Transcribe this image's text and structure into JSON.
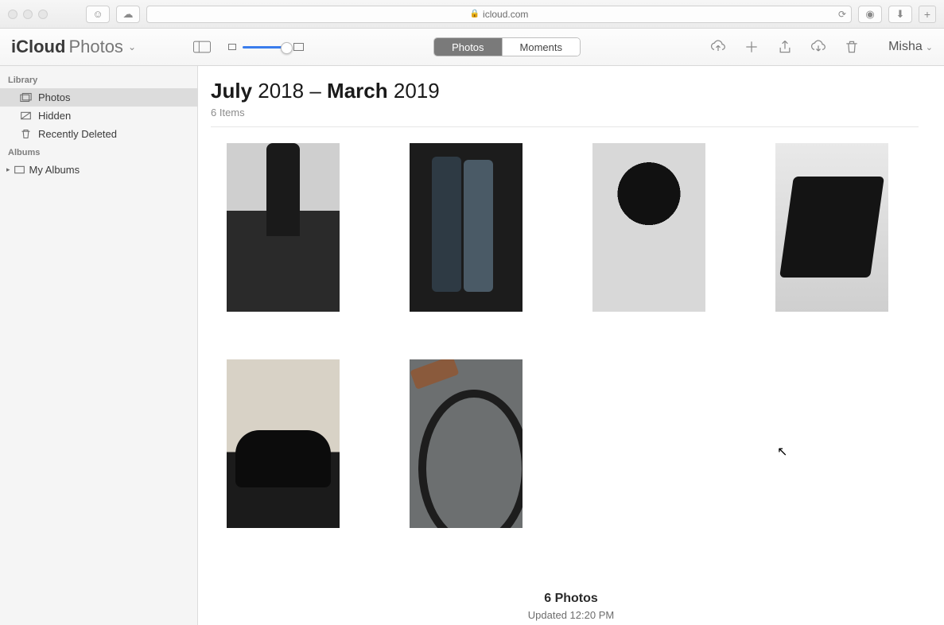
{
  "browser": {
    "domain": "icloud.com"
  },
  "app": {
    "brand": "iCloud",
    "section": "Photos"
  },
  "segmented": {
    "photos": "Photos",
    "moments": "Moments",
    "active": "photos"
  },
  "user": {
    "name": "Misha"
  },
  "sidebar": {
    "library_header": "Library",
    "items": [
      {
        "label": "Photos",
        "icon": "photos-stack-icon",
        "selected": true
      },
      {
        "label": "Hidden",
        "icon": "hidden-icon",
        "selected": false
      },
      {
        "label": "Recently Deleted",
        "icon": "trash-icon",
        "selected": false
      }
    ],
    "albums_header": "Albums",
    "my_albums": "My Albums"
  },
  "header": {
    "month_from": "July",
    "year_from": "2018",
    "separator": "–",
    "month_to": "March",
    "year_to": "2019",
    "count_label": "6 Items"
  },
  "thumbs": [
    {
      "name": "photo-person-rooftop"
    },
    {
      "name": "photo-couple"
    },
    {
      "name": "photo-motorcycle-gauge"
    },
    {
      "name": "photo-umbrella-man"
    },
    {
      "name": "photo-vintage-car"
    },
    {
      "name": "photo-bicycle"
    }
  ],
  "footer": {
    "summary": "6 Photos",
    "updated": "Updated 12:20 PM"
  }
}
